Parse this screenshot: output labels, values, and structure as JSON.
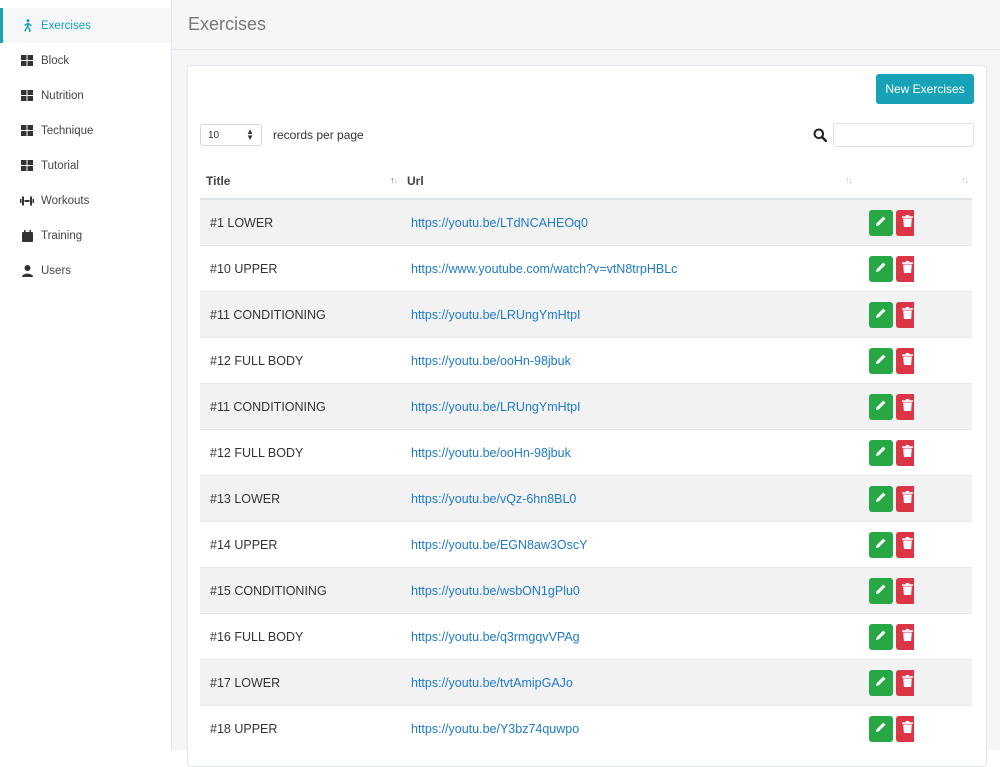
{
  "sidebar": {
    "items": [
      {
        "label": "Exercises",
        "icon": "running-icon",
        "active": true
      },
      {
        "label": "Block",
        "icon": "grid-icon"
      },
      {
        "label": "Nutrition",
        "icon": "grid-icon"
      },
      {
        "label": "Technique",
        "icon": "grid-icon"
      },
      {
        "label": "Tutorial",
        "icon": "grid-icon"
      },
      {
        "label": "Workouts",
        "icon": "dumbbell-icon"
      },
      {
        "label": "Training",
        "icon": "calendar-icon"
      },
      {
        "label": "Users",
        "icon": "user-icon"
      }
    ]
  },
  "header": {
    "title": "Exercises"
  },
  "toolbar": {
    "new_button_label": "New Exercises",
    "page_length_value": "10",
    "page_length_label": "records per page",
    "search_placeholder": ""
  },
  "table": {
    "columns": [
      "Title",
      "Url",
      "",
      ""
    ],
    "rows": [
      {
        "title": "#1 LOWER",
        "url": "https://youtu.be/LTdNCAHEOq0"
      },
      {
        "title": "#10 UPPER",
        "url": "https://www.youtube.com/watch?v=vtN8trpHBLc"
      },
      {
        "title": "#11 CONDITIONING",
        "url": "https://youtu.be/LRUngYmHtpI"
      },
      {
        "title": "#12 FULL BODY",
        "url": "https://youtu.be/ooHn-98jbuk"
      },
      {
        "title": "#11 CONDITIONING",
        "url": "https://youtu.be/LRUngYmHtpI"
      },
      {
        "title": "#12 FULL BODY",
        "url": "https://youtu.be/ooHn-98jbuk"
      },
      {
        "title": "#13 LOWER",
        "url": "https://youtu.be/vQz-6hn8BL0"
      },
      {
        "title": "#14 UPPER",
        "url": "https://youtu.be/EGN8aw3OscY"
      },
      {
        "title": "#15 CONDITIONING",
        "url": "https://youtu.be/wsbON1gPlu0"
      },
      {
        "title": "#16 FULL BODY",
        "url": "https://youtu.be/q3rmgqvVPAg"
      },
      {
        "title": "#17 LOWER",
        "url": "https://youtu.be/tvtAmipGAJo"
      },
      {
        "title": "#18 UPPER",
        "url": "https://youtu.be/Y3bz74quwpo"
      }
    ]
  },
  "colors": {
    "accent": "#17a2b8",
    "edit": "#28a745",
    "delete": "#dc3545",
    "link": "#1f7ac9"
  }
}
